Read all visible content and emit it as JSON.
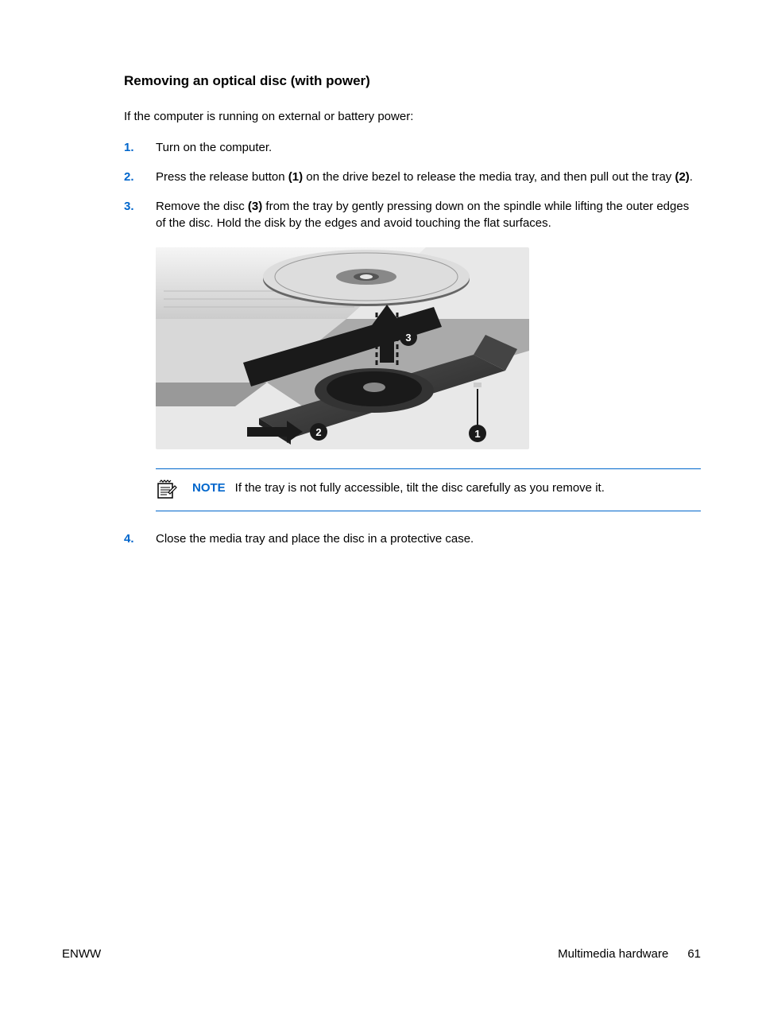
{
  "title": "Removing an optical disc (with power)",
  "intro": "If the computer is running on external or battery power:",
  "steps": [
    {
      "num": "1.",
      "pre": "Turn on the computer.",
      "b1": "",
      "mid": "",
      "b2": "",
      "post": ""
    },
    {
      "num": "2.",
      "pre": "Press the release button ",
      "b1": "(1)",
      "mid": " on the drive bezel to release the media tray, and then pull out the tray ",
      "b2": "(2)",
      "post": "."
    },
    {
      "num": "3.",
      "pre": "Remove the disc ",
      "b1": "(3)",
      "mid": " from the tray by gently pressing down on the spindle while lifting the outer edges of the disc. Hold the disk by the edges and avoid touching the flat surfaces.",
      "b2": "",
      "post": ""
    }
  ],
  "note": {
    "label": "NOTE",
    "text": "If the tray is not fully accessible, tilt the disc carefully as you remove it."
  },
  "step4": {
    "num": "4.",
    "text": "Close the media tray and place the disc in a protective case."
  },
  "footer": {
    "left": "ENWW",
    "section": "Multimedia hardware",
    "page": "61"
  },
  "callouts": {
    "c1": "1",
    "c2": "2",
    "c3": "3"
  }
}
